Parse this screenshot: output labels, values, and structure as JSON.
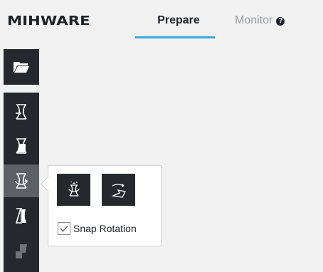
{
  "header": {
    "logo_text": "MIHWARE",
    "tabs": [
      {
        "label": "Prepare",
        "active": true
      },
      {
        "label": "Monitor",
        "active": false,
        "help_icon": "question-circle-icon",
        "help_glyph": "?"
      }
    ]
  },
  "toolbar": {
    "open_icon": "folder-open-icon",
    "tools": [
      {
        "icon": "move-icon",
        "active": false
      },
      {
        "icon": "scale-icon",
        "active": false
      },
      {
        "icon": "rotate-icon",
        "active": true
      },
      {
        "icon": "mirror-icon",
        "active": false
      },
      {
        "icon": "support-icon",
        "active": false
      }
    ]
  },
  "rotate_popup": {
    "buttons": [
      {
        "icon": "rotate-around-axis-icon"
      },
      {
        "icon": "lay-flat-icon"
      }
    ],
    "snap_rotation": {
      "label": "Snap Rotation",
      "checked": true
    }
  },
  "colors": {
    "toolbar_bg": "#25282c",
    "active_tool_bg": "#5d6166",
    "tab_underline": "#3aa9dc",
    "page_bg": "#f2f2f2"
  }
}
